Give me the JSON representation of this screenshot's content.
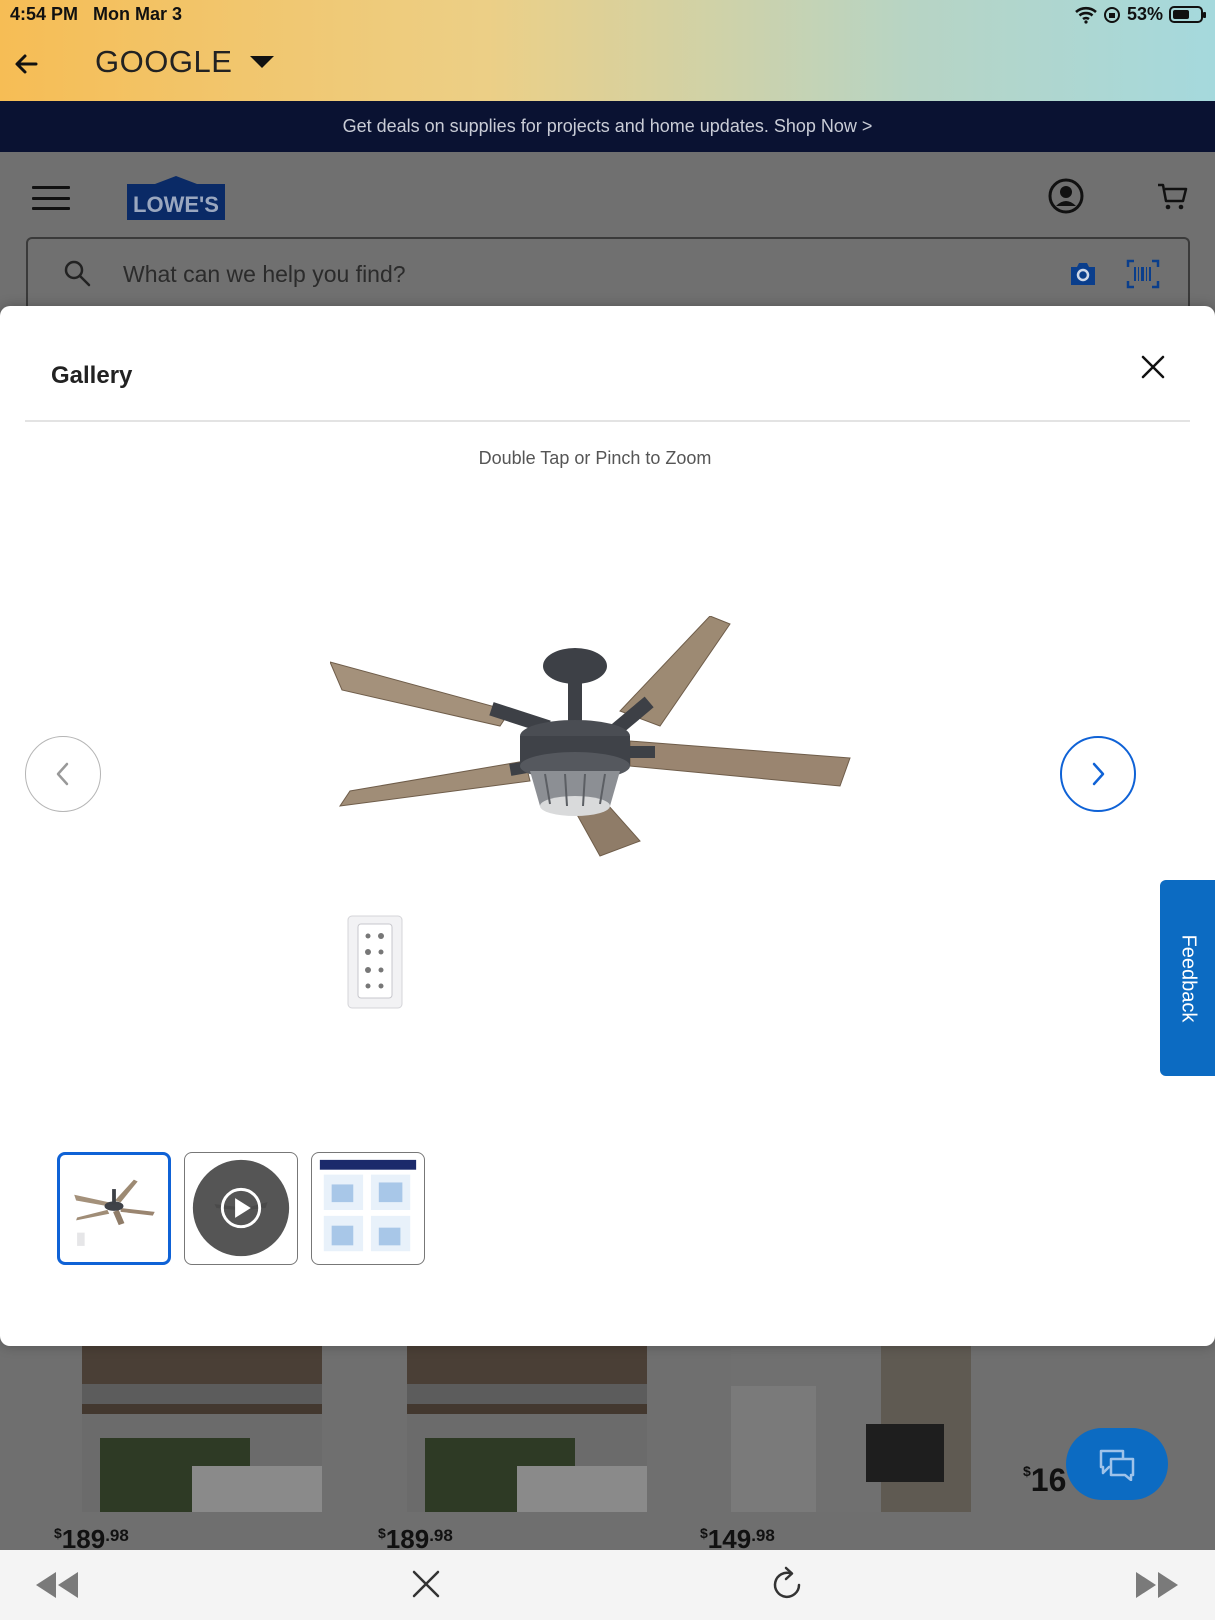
{
  "status_bar": {
    "time": "4:54 PM",
    "date": "Mon Mar 3",
    "battery_text": "53%",
    "battery_level": 0.53
  },
  "app_bar": {
    "title": "GOOGLE"
  },
  "promo": {
    "text": "Get deals on supplies for projects and home updates. Shop Now >"
  },
  "header": {
    "logo_text": "LOWE'S"
  },
  "search": {
    "placeholder": "What can we help you find?"
  },
  "modal": {
    "title": "Gallery",
    "zoom_hint": "Double Tap or Pinch to Zoom"
  },
  "feedback": {
    "label": "Feedback"
  },
  "products": [
    {
      "dollars": "189",
      "cents": ".98"
    },
    {
      "dollars": "189",
      "cents": ".98"
    },
    {
      "dollars": "149",
      "cents": ".98"
    },
    {
      "dollars": "16"
    }
  ],
  "colors": {
    "accent_blue": "#0f62d6",
    "promo_bg": "#0a1232",
    "feedback_bg": "#0c6bc2",
    "lowes_blue": "#004990"
  },
  "icons": [
    "back-arrow-icon",
    "chevron-down-icon",
    "wifi-icon",
    "hamburger-icon",
    "account-icon",
    "cart-icon",
    "search-icon",
    "camera-icon",
    "barcode-icon",
    "close-icon",
    "chevron-left-icon",
    "chevron-right-icon",
    "play-icon",
    "chat-icon",
    "rewind-icon",
    "reload-icon",
    "fast-forward-icon"
  ]
}
